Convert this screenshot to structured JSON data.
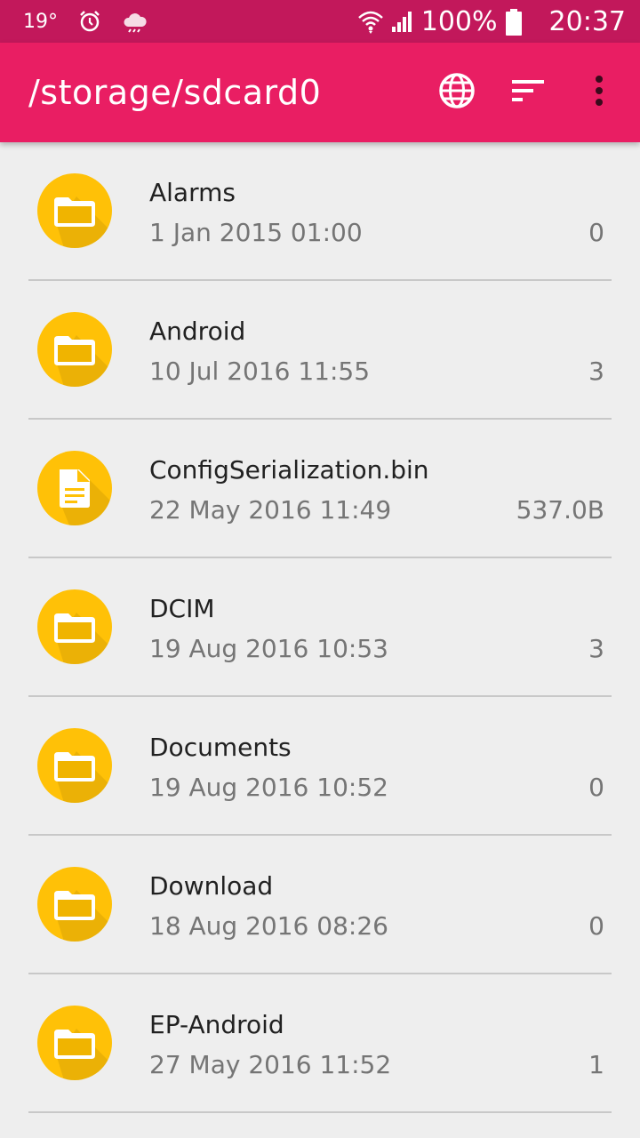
{
  "status_bar": {
    "temperature": "19°",
    "battery_percent": "100%",
    "time": "20:37"
  },
  "app_bar": {
    "title": "/storage/sdcard0",
    "actions": [
      "globe-icon",
      "sort-icon",
      "more-vert-icon"
    ]
  },
  "files": [
    {
      "name": "Alarms",
      "date": "1 Jan 2015 01:00",
      "size": "0",
      "type": "folder"
    },
    {
      "name": "Android",
      "date": "10 Jul 2016 11:55",
      "size": "3",
      "type": "folder"
    },
    {
      "name": "ConfigSerialization.bin",
      "date": "22 May 2016 11:49",
      "size": "537.0B",
      "type": "file"
    },
    {
      "name": "DCIM",
      "date": "19 Aug 2016 10:53",
      "size": "3",
      "type": "folder"
    },
    {
      "name": "Documents",
      "date": "19 Aug 2016 10:52",
      "size": "0",
      "type": "folder"
    },
    {
      "name": "Download",
      "date": "18 Aug 2016 08:26",
      "size": "0",
      "type": "folder"
    },
    {
      "name": "EP-Android",
      "date": "27 May 2016 11:52",
      "size": "1",
      "type": "folder"
    }
  ],
  "colors": {
    "status_bar": "#c2185b",
    "app_bar": "#e91e63",
    "icon_circle": "#ffc107",
    "background": "#eeeeee"
  }
}
